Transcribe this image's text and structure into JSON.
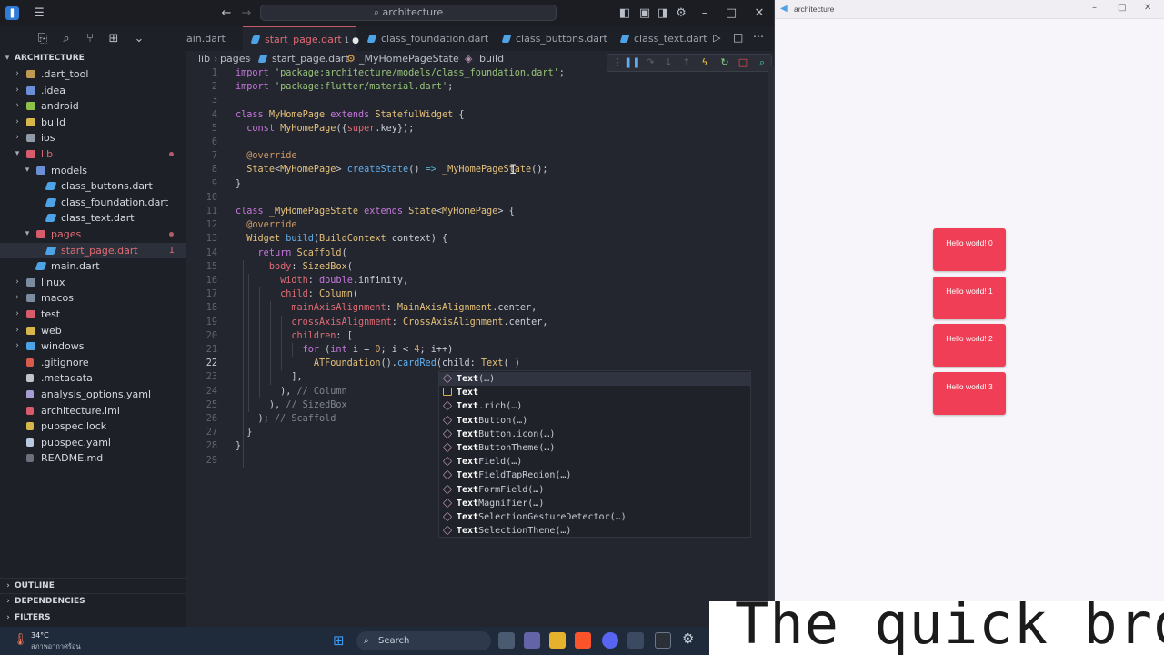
{
  "vscode": {
    "command_center": "architecture",
    "explorer_title": "ARCHITECTURE",
    "tree": [
      {
        "label": ".dart_tool",
        "depth": 0,
        "type": "folder",
        "expanded": false
      },
      {
        "label": ".idea",
        "depth": 0,
        "type": "folder",
        "expanded": false
      },
      {
        "label": "android",
        "depth": 0,
        "type": "folder",
        "expanded": false
      },
      {
        "label": "build",
        "depth": 0,
        "type": "folder",
        "expanded": false
      },
      {
        "label": "ios",
        "depth": 0,
        "type": "folder",
        "expanded": false
      },
      {
        "label": "lib",
        "depth": 0,
        "type": "folder",
        "expanded": true,
        "modified": true
      },
      {
        "label": "models",
        "depth": 1,
        "type": "folder",
        "expanded": true
      },
      {
        "label": "class_buttons.dart",
        "depth": 2,
        "type": "dart"
      },
      {
        "label": "class_foundation.dart",
        "depth": 2,
        "type": "dart"
      },
      {
        "label": "class_text.dart",
        "depth": 2,
        "type": "dart"
      },
      {
        "label": "pages",
        "depth": 1,
        "type": "folder",
        "expanded": true,
        "modified": true
      },
      {
        "label": "start_page.dart",
        "depth": 2,
        "type": "dart",
        "selected": true,
        "count": "1"
      },
      {
        "label": "main.dart",
        "depth": 1,
        "type": "dart"
      },
      {
        "label": "linux",
        "depth": 0,
        "type": "folder",
        "expanded": false
      },
      {
        "label": "macos",
        "depth": 0,
        "type": "folder",
        "expanded": false
      },
      {
        "label": "test",
        "depth": 0,
        "type": "folder",
        "expanded": false
      },
      {
        "label": "web",
        "depth": 0,
        "type": "folder",
        "expanded": false
      },
      {
        "label": "windows",
        "depth": 0,
        "type": "folder",
        "expanded": false
      },
      {
        "label": ".gitignore",
        "depth": 0,
        "type": "file"
      },
      {
        "label": ".metadata",
        "depth": 0,
        "type": "file"
      },
      {
        "label": "analysis_options.yaml",
        "depth": 0,
        "type": "file"
      },
      {
        "label": "architecture.iml",
        "depth": 0,
        "type": "file"
      },
      {
        "label": "pubspec.lock",
        "depth": 0,
        "type": "file"
      },
      {
        "label": "pubspec.yaml",
        "depth": 0,
        "type": "file"
      },
      {
        "label": "README.md",
        "depth": 0,
        "type": "file"
      }
    ],
    "panels": [
      "OUTLINE",
      "DEPENDENCIES",
      "FILTERS"
    ],
    "tabs": [
      {
        "label": "ain.dart",
        "active": false
      },
      {
        "label": "start_page.dart",
        "active": true,
        "badge": "1"
      },
      {
        "label": "class_foundation.dart",
        "active": false
      },
      {
        "label": "class_buttons.dart",
        "active": false
      },
      {
        "label": "class_text.dart",
        "active": false
      }
    ],
    "breadcrumb": [
      "lib",
      "pages",
      "start_page.dart",
      "_MyHomePageState",
      "build"
    ],
    "current_line": 22,
    "suggestions": [
      {
        "match": "Text",
        "rest": "(…)",
        "kind": "method",
        "selected": true
      },
      {
        "match": "Text",
        "rest": "",
        "kind": "class"
      },
      {
        "match": "Text",
        "rest": ".rich(…)",
        "kind": "method"
      },
      {
        "match": "Text",
        "rest": "Button(…)",
        "kind": "method"
      },
      {
        "match": "Text",
        "rest": "Button.icon(…)",
        "kind": "method"
      },
      {
        "match": "Text",
        "rest": "ButtonTheme(…)",
        "kind": "method"
      },
      {
        "match": "Text",
        "rest": "Field(…)",
        "kind": "method"
      },
      {
        "match": "Text",
        "rest": "FieldTapRegion(…)",
        "kind": "method"
      },
      {
        "match": "Text",
        "rest": "FormField(…)",
        "kind": "method"
      },
      {
        "match": "Text",
        "rest": "Magnifier(…)",
        "kind": "method"
      },
      {
        "match": "Text",
        "rest": "SelectionGestureDetector(…)",
        "kind": "method"
      },
      {
        "match": "Text",
        "rest": "SelectionTheme(…)",
        "kind": "method"
      }
    ]
  },
  "app": {
    "window_title": "architecture",
    "cards": [
      "Hello world! 0",
      "Hello world! 1",
      "Hello world! 2",
      "Hello world! 3"
    ]
  },
  "taskbar": {
    "weather_temp": "34°C",
    "weather_desc": "สภาพอากาศร้อน",
    "search_label": "Search"
  },
  "overlay_text": "The quick bro",
  "colors": {
    "accent": "#e06c75",
    "card": "#ef3e56",
    "dart_icon": "#4da3e6"
  }
}
